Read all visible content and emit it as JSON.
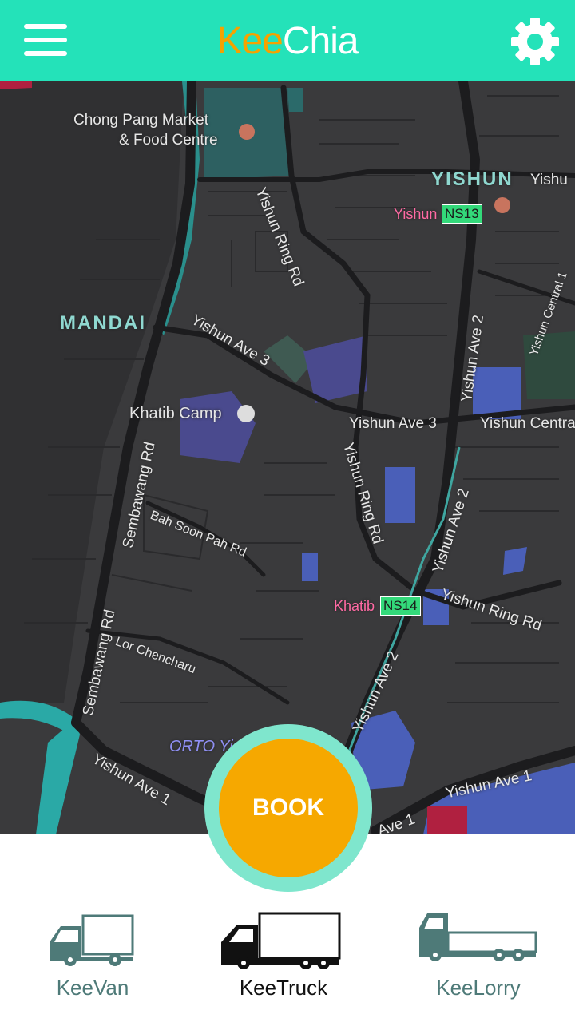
{
  "header": {
    "title_part1": "Kee",
    "title_part2": "Chia",
    "title_color_part1": "#f5a200",
    "title_color_part2": "#ffffff",
    "background": "#24e2b9",
    "menu_icon": "hamburger-menu-icon",
    "settings_icon": "gear-icon"
  },
  "map": {
    "labels": {
      "chong_pang_1": "Chong Pang Market",
      "chong_pang_2": "& Food Centre",
      "yishun": "YISHUN",
      "yishun_cut": "Yishu",
      "yishun_ring_rd_top": "Yishun Ring Rd",
      "yishun_station": "Yishun",
      "ns13": "NS13",
      "mandai": "MANDAI",
      "yishun_ave3_left": "Yishun Ave 3",
      "yishun_ave2_top": "Yishun Ave 2",
      "yishun_central_1": "Yishun Central 1",
      "khatib_camp": "Khatib Camp",
      "yishun_ave3_mid": "Yishun Ave 3",
      "yishun_central": "Yishun Centra",
      "sembawang_rd_top": "Sembawang Rd",
      "yishun_ring_rd_mid": "Yishun Ring Rd",
      "yishun_ave2_mid": "Yishun Ave 2",
      "bah_soon_pah": "Bah Soon Pah Rd",
      "khatib_station": "Khatib",
      "ns14": "NS14",
      "yishun_ring_rd_right": "Yishun Ring Rd",
      "sembawang_rd_bottom": "Sembawang Rd",
      "lor_chencharu": "Lor Chencharu",
      "yishun_ave2_low": "Yishun Ave 2",
      "orto": "ORTO Yish",
      "yishun_ave1_left": "Yishun Ave 1",
      "yishun_ave1_right": "Yishun Ave 1",
      "ave1_cut": "Ave 1"
    }
  },
  "book_button": {
    "label": "BOOK",
    "color": "#f6a800"
  },
  "vehicles": [
    {
      "label": "KeeVan",
      "icon": "van-icon",
      "selected": false
    },
    {
      "label": "KeeTruck",
      "icon": "truck-icon",
      "selected": true
    },
    {
      "label": "KeeLorry",
      "icon": "lorry-icon",
      "selected": false
    }
  ],
  "colors": {
    "vehicle_inactive": "#4e7a78",
    "vehicle_active": "#111111"
  }
}
